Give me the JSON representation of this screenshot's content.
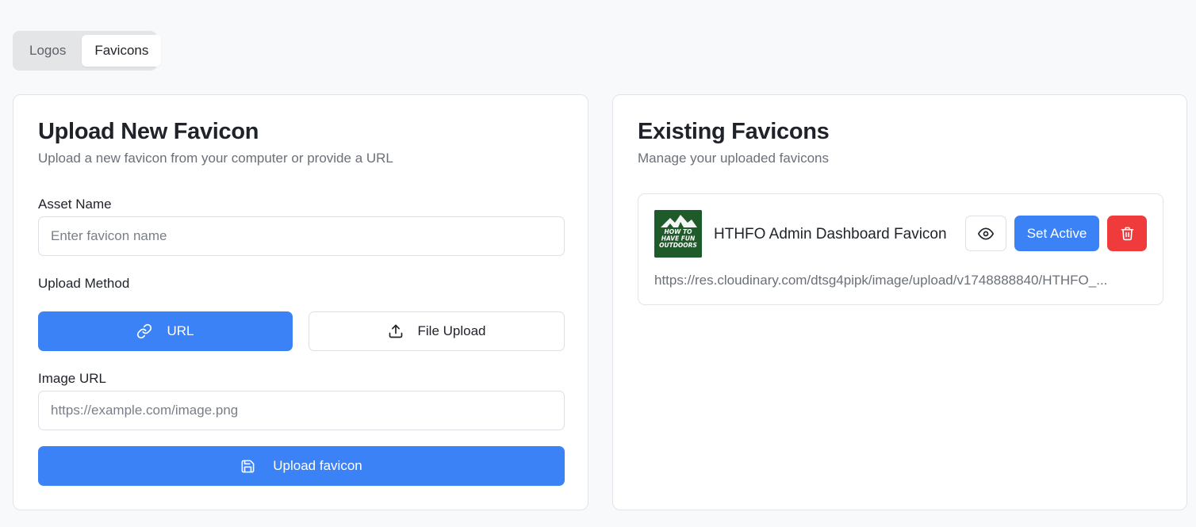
{
  "tabs": [
    {
      "label": "Logos",
      "active": false
    },
    {
      "label": "Favicons",
      "active": true
    }
  ],
  "upload": {
    "title": "Upload New Favicon",
    "subtitle": "Upload a new favicon from your computer or provide a URL",
    "asset_name_label": "Asset Name",
    "asset_name_placeholder": "Enter favicon name",
    "asset_name_value": "",
    "method_label": "Upload Method",
    "method_url_label": "URL",
    "method_file_label": "File Upload",
    "selected_method": "URL",
    "image_url_label": "Image URL",
    "image_url_placeholder": "https://example.com/image.png",
    "image_url_value": "",
    "submit_label": "Upload favicon"
  },
  "existing": {
    "title": "Existing Favicons",
    "subtitle": "Manage your uploaded favicons",
    "items": [
      {
        "name": "HTHFO Admin Dashboard Favicon",
        "url": "https://res.cloudinary.com/dtsg4pipk/image/upload/v1748888840/HTHFO_...",
        "thumb_text": [
          "HOW TO",
          "HAVE FUN",
          "OUTDOORS"
        ],
        "set_active_label": "Set Active"
      }
    ]
  },
  "icons": {
    "url_method": "link-icon",
    "file_method": "upload-icon",
    "submit": "save-icon",
    "view": "eye-icon",
    "delete": "trash-icon"
  },
  "colors": {
    "primary": "#3b82f6",
    "danger": "#ef3b3b",
    "page_bg": "#f8f9fb",
    "thumb_bg": "#1f5a2a"
  }
}
